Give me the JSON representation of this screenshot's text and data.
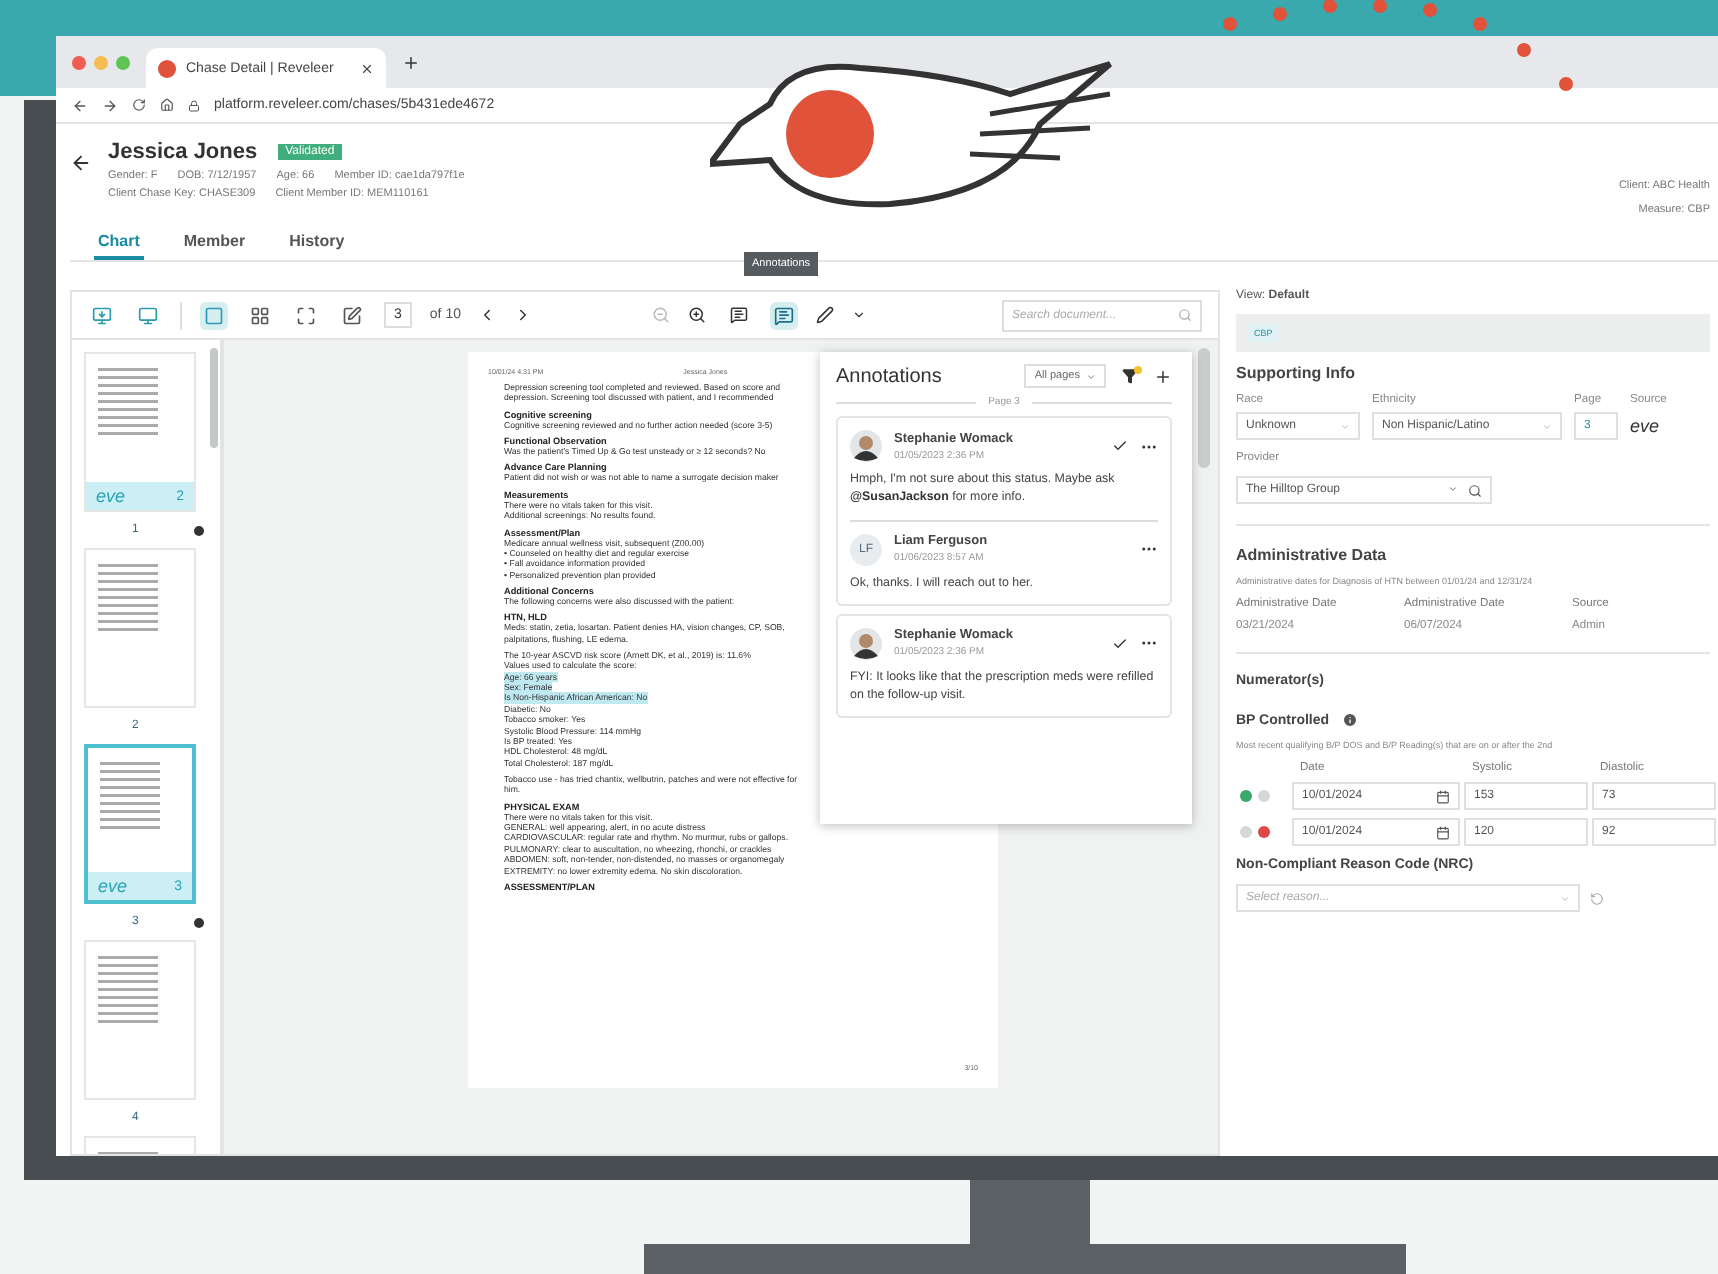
{
  "browser": {
    "tab_title": "Chase Detail | Reveleer",
    "url": "platform.reveleer.com/chases/5b431ede4672"
  },
  "patient": {
    "name": "Jessica Jones",
    "badge": "Validated",
    "details": [
      [
        "Gender: F",
        "DOB: 7/12/1957",
        "Age: 66",
        "Member ID: cae1da797f1e"
      ],
      [
        "Client Chase Key: CHASE309",
        "Client Member ID: MEM110161"
      ]
    ]
  },
  "client_info": [
    "Client: ABC Health",
    "Measure: CBP"
  ],
  "tabs": [
    {
      "label": "Chart",
      "selected": true
    },
    {
      "label": "Member",
      "selected": false
    },
    {
      "label": "History",
      "selected": false
    }
  ],
  "toolbar": {
    "layout_buttons": [
      {
        "kind": "single",
        "selected": true
      },
      {
        "kind": "grid",
        "selected": false
      },
      {
        "kind": "fit",
        "selected": false
      },
      {
        "kind": "edit",
        "selected": false
      }
    ],
    "page": "3",
    "page_total": "of 10",
    "annotations_active": true,
    "tooltip": "Annotations",
    "search_placeholder": "Search document..."
  },
  "thumbnails": [
    {
      "number": "1",
      "selected": false,
      "annotated": true,
      "badge": {
        "logo": "eve",
        "count": "2"
      }
    },
    {
      "number": "2",
      "selected": false,
      "annotated": false
    },
    {
      "number": "3",
      "selected": true,
      "annotated": true,
      "badge": {
        "logo": "eve",
        "count": "3"
      }
    },
    {
      "number": "4",
      "selected": false,
      "annotated": false
    },
    {
      "selected": false
    }
  ],
  "document": {
    "header": [
      "10/01/24 4:31 PM",
      "Jessica Jones"
    ],
    "blocks": [
      {
        "lines": [
          "Depression screening tool completed and reviewed. Based on score and",
          "depression. Screening tool discussed with patient, and I recommended"
        ]
      },
      {
        "heading": "Cognitive screening",
        "lines": [
          "Cognitive screening reviewed and no further action needed (score 3-5)"
        ]
      },
      {
        "heading": "Functional Observation",
        "lines": [
          "Was the patient's Timed Up & Go test unsteady or ≥ 12 seconds? No"
        ]
      },
      {
        "heading": "Advance Care Planning",
        "lines": [
          "Patient did not wish or was not able to name a surrogate decision maker"
        ]
      },
      {
        "heading": "Measurements",
        "lines": [
          "There were no vitals taken for this visit.",
          "Additional screenings: No results found."
        ]
      },
      {
        "heading": "Assessment/Plan",
        "lines": [
          "Medicare annual wellness visit, subsequent (Z00.00)",
          "• Counseled on healthy diet and regular exercise",
          "• Fall avoidance information provided",
          "• Personalized prevention plan provided"
        ]
      },
      {
        "heading": "Additional Concerns",
        "lines": [
          "The following concerns were also discussed with the patient:"
        ]
      },
      {
        "heading": "HTN, HLD",
        "lines": [
          "Meds: statin, zetia, losartan. Patient denies HA, vision changes, CP, SOB,",
          "palpitations, flushing, LE edema."
        ]
      },
      {
        "lines": [
          {
            "text": "The 10-year ASCVD risk score (Arnett DK, et al., 2019) is: 11.6%",
            "highlighted": false
          },
          {
            "text": "Values used to calculate the score:",
            "highlighted": false
          },
          {
            "text": "Age: 66 years",
            "highlighted": true
          },
          {
            "text": "Sex: Female",
            "highlighted": true
          },
          {
            "text": "Is Non-Hispanic African American: No",
            "highlighted": true
          },
          {
            "text": "Diabetic: No",
            "highlighted": false
          },
          {
            "text": "Tobacco smoker: Yes",
            "highlighted": false
          },
          {
            "text": "Systolic Blood Pressure: 114 mmHg",
            "highlighted": false
          },
          {
            "text": "Is BP treated: Yes",
            "highlighted": false
          },
          {
            "text": "HDL Cholesterol: 48 mg/dL",
            "highlighted": false
          },
          {
            "text": "Total Cholesterol: 187 mg/dL",
            "highlighted": false
          }
        ]
      },
      {
        "lines": [
          "Tobacco use - has tried chantix, wellbutrin, patches and were not effective for him."
        ]
      },
      {
        "heading": "PHYSICAL EXAM",
        "lines": [
          "There were no vitals taken for this visit.",
          "GENERAL: well appearing, alert, in no acute distress",
          "CARDIOVASCULAR: regular rate and rhythm. No murmur, rubs or gallops.",
          "PULMONARY: clear to auscultation, no wheezing, rhonchi, or crackles",
          "ABDOMEN: soft, non-tender, non-distended, no masses or organomegaly",
          "EXTREMITY: no lower extremity edema. No skin discoloration."
        ]
      },
      {
        "heading": "ASSESSMENT/PLAN"
      }
    ],
    "footer": "3/10"
  },
  "annotations": {
    "title": "Annotations",
    "filter": "All pages",
    "page_label": "Page 3",
    "threads": [
      {
        "comments": [
          {
            "author": "Stephanie Womack",
            "kind": "photo",
            "time": "01/05/2023 2:36 PM",
            "text": "Hmph, I'm not sure about this status. Maybe ask **@SusanJackson** for more info.",
            "resolvable": true
          },
          {
            "author": "Liam Ferguson",
            "kind": "initials",
            "initials": "LF",
            "time": "01/06/2023 8:57 AM",
            "text": "Ok, thanks. I will reach out to her.",
            "resolvable": false
          }
        ]
      },
      {
        "comments": [
          {
            "author": "Stephanie Womack",
            "kind": "photo",
            "time": "01/05/2023 2:36 PM",
            "text": "FYI: It looks like that the prescription meds were refilled on the follow-up visit.",
            "resolvable": true
          }
        ]
      }
    ]
  },
  "view": "View: **Default**",
  "measure_chip": "CBP",
  "supporting_info": {
    "title": "Supporting Info",
    "fields": [
      {
        "label": "Race",
        "kind": "select",
        "value": "Unknown"
      },
      {
        "label": "Ethnicity",
        "kind": "select",
        "value": "Non Hispanic/Latino"
      },
      {
        "label": "Page",
        "kind": "input",
        "value": "3"
      },
      {
        "label": "Source",
        "kind": "logo",
        "value": "eve"
      }
    ],
    "provider": {
      "label": "Provider",
      "value": "The Hilltop Group"
    }
  },
  "administrative": {
    "title": "Administrative Data",
    "description": "Administrative dates for Diagnosis of HTN between 01/01/24 and 12/31/24",
    "columns": [
      "Administrative Date",
      "Administrative Date",
      "Source"
    ],
    "rows": [
      [
        "03/21/2024",
        "06/07/2024",
        "Admin"
      ]
    ]
  },
  "numerator": {
    "title": "Numerator(s)",
    "measure": "BP Controlled",
    "description": "Most recent qualifying B/P DOS and B/P Reading(s) that are on or after the 2nd",
    "columns": [
      "Date",
      "Systolic",
      "Diastolic"
    ],
    "readings": [
      {
        "compliant": true,
        "date": "10/01/2024",
        "systolic": "153",
        "diastolic": "73"
      },
      {
        "compliant": false,
        "date": "10/01/2024",
        "systolic": "120",
        "diastolic": "92"
      }
    ]
  },
  "nrc": {
    "title": "Non-Compliant Reason Code (NRC)",
    "placeholder": "Select reason..."
  }
}
